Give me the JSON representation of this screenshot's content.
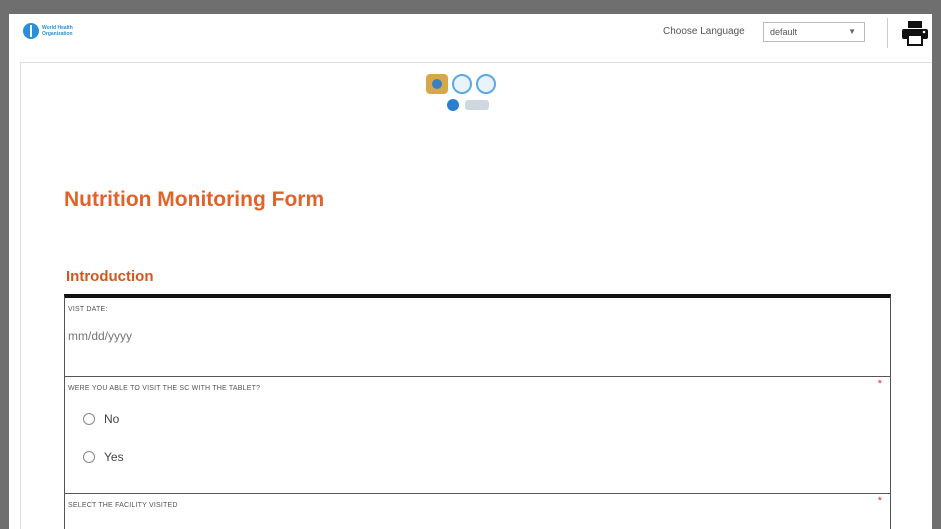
{
  "header": {
    "org_name": "World Health Organization",
    "language_label": "Choose Language",
    "language_value": "default"
  },
  "form": {
    "title": "Nutrition Monitoring Form",
    "section": "Introduction",
    "fields": {
      "visit_date": {
        "label": "VIST DATE:",
        "placeholder": "mm/dd/yyyy"
      },
      "tablet": {
        "label": "WERE YOU ABLE TO VISIT THE SC WITH THE TABLET?",
        "required": "*",
        "options": [
          "No",
          "Yes"
        ]
      },
      "facility": {
        "label": "SELECT THE FACILITY VISITED",
        "required": "*"
      }
    }
  },
  "colors": {
    "title": "#e2632a",
    "section": "#d2571e",
    "required": "#d9342b",
    "frame": "#6f6f6f"
  },
  "icons": [
    "who-logo-icon",
    "print-icon",
    "chevron-down-icon"
  ]
}
